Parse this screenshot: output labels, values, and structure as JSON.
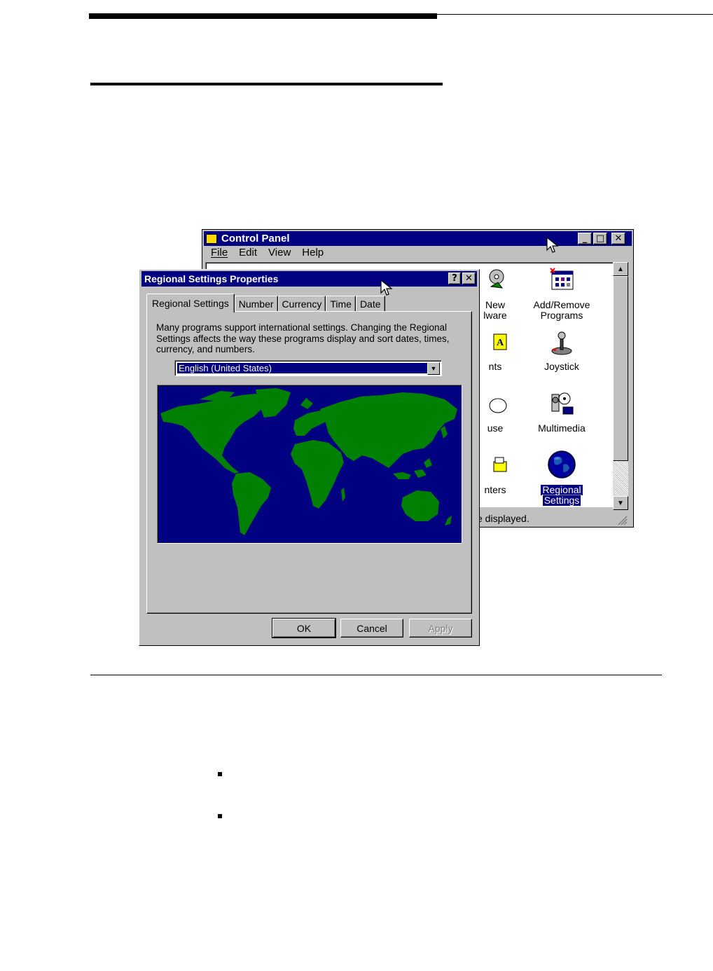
{
  "control_panel": {
    "title": "Control Panel",
    "menu": [
      "File",
      "Edit",
      "View",
      "Help"
    ],
    "items": [
      {
        "label_line1": "New",
        "label_line2": "lware",
        "icon": "add-hardware-icon"
      },
      {
        "label_line1": "Add/Remove",
        "label_line2": "Programs",
        "icon": "add-remove-programs-icon"
      },
      {
        "label_line1": "nts",
        "label_line2": "",
        "icon": "fonts-icon"
      },
      {
        "label_line1": "Joystick",
        "label_line2": "",
        "icon": "joystick-icon"
      },
      {
        "label_line1": "use",
        "label_line2": "",
        "icon": "mouse-icon"
      },
      {
        "label_line1": "Multimedia",
        "label_line2": "",
        "icon": "multimedia-icon"
      },
      {
        "label_line1": "nters",
        "label_line2": "",
        "icon": "printers-icon"
      },
      {
        "label_line1": "Regional",
        "label_line2": "Settings",
        "icon": "globe-icon"
      }
    ],
    "status": "e displayed."
  },
  "regional": {
    "title": "Regional Settings Properties",
    "tabs": [
      "Regional Settings",
      "Number",
      "Currency",
      "Time",
      "Date"
    ],
    "description": "Many programs support international settings. Changing the Regional Settings affects the way these programs display and sort dates, times, currency, and numbers.",
    "locale": "English (United States)",
    "buttons": {
      "ok": "OK",
      "cancel": "Cancel",
      "apply": "Apply"
    }
  },
  "colors": {
    "titlebar": "#000080",
    "face": "#c0c0c0",
    "map_ocean": "#000080",
    "map_land": "#008000"
  }
}
